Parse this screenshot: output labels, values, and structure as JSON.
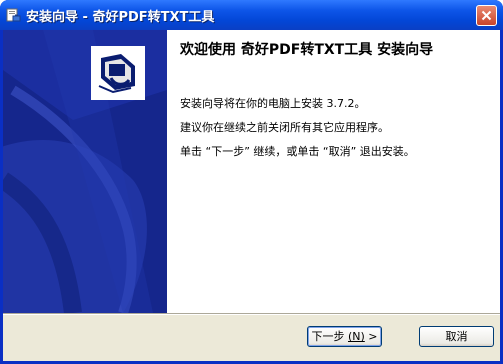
{
  "window": {
    "title": "安装向导 - 奇好PDF转TXT工具"
  },
  "content": {
    "welcome_heading": "欢迎使用 奇好PDF转TXT工具 安装向导",
    "paragraph_install": "安装向导将在你的电脑上安装 3.7.2。",
    "paragraph_close_apps": "建议你在继续之前关闭所有其它应用程序。",
    "paragraph_instructions": "单击 “下一步” 继续，或单击 “取消” 退出安装。"
  },
  "buttons": {
    "next_label": "下一步",
    "next_mnemonic": "(N)",
    "next_arrow": ">",
    "cancel_label": "取消"
  },
  "colors": {
    "titlebar": "#0a55e4",
    "banner": "#1b2ea0",
    "dialog_background": "#ece9d8",
    "close_button": "#d4553a"
  }
}
